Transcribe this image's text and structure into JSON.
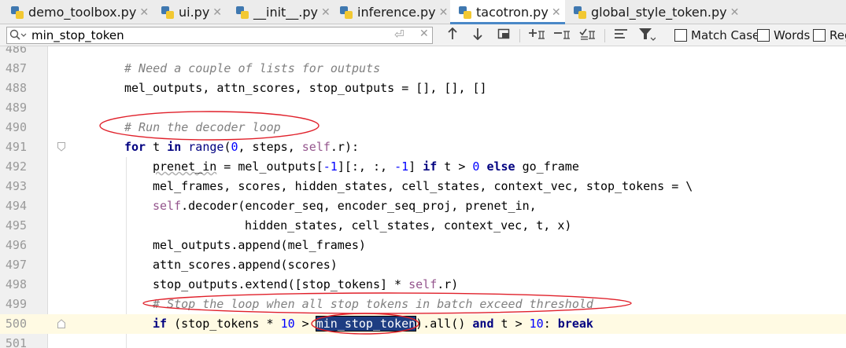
{
  "tabs": [
    {
      "label": "demo_toolbox.py",
      "active": false
    },
    {
      "label": "ui.py",
      "active": false
    },
    {
      "label": "__init__.py",
      "active": false
    },
    {
      "label": "inference.py",
      "active": false
    },
    {
      "label": "tacotron.py",
      "active": true
    },
    {
      "label": "global_style_token.py",
      "active": false
    }
  ],
  "search": {
    "value": "min_stop_token",
    "options": {
      "match_case": "Match Case",
      "words": "Words",
      "regex": "Reg"
    }
  },
  "editor": {
    "first_line_partial": "486",
    "lines": [
      {
        "n": "487",
        "text": "# Need a couple of lists for outputs"
      },
      {
        "n": "488",
        "text": "mel_outputs, attn_scores, stop_outputs = [], [], []"
      },
      {
        "n": "489",
        "text": ""
      },
      {
        "n": "490",
        "text": "# Run the decoder loop"
      },
      {
        "n": "491",
        "text": "for t in range(0, steps, self.r):"
      },
      {
        "n": "492",
        "text": "prenet_in = mel_outputs[-1][:, :, -1] if t > 0 else go_frame"
      },
      {
        "n": "493",
        "text": "mel_frames, scores, hidden_states, cell_states, context_vec, stop_tokens = \\"
      },
      {
        "n": "494",
        "text": "self.decoder(encoder_seq, encoder_seq_proj, prenet_in,"
      },
      {
        "n": "495",
        "text": "hidden_states, cell_states, context_vec, t, x)"
      },
      {
        "n": "496",
        "text": "mel_outputs.append(mel_frames)"
      },
      {
        "n": "497",
        "text": "attn_scores.append(scores)"
      },
      {
        "n": "498",
        "text": "stop_outputs.extend([stop_tokens] * self.r)"
      },
      {
        "n": "499",
        "text": "# Stop the loop when all stop tokens in batch exceed threshold"
      },
      {
        "n": "500",
        "text": "if (stop_tokens * 10 > min_stop_token).all() and t > 10: break"
      },
      {
        "n": "501",
        "text": ""
      }
    ]
  },
  "colors": {
    "comment": "#808080",
    "keyword": "#000080",
    "number": "#0000ff",
    "self": "#94558d",
    "search_match_bg": "#1e3d82",
    "annotation_red": "#e0202a",
    "current_line_bg": "#fffae3"
  },
  "icons": [
    "python-file-icon",
    "close-tab-icon",
    "search-icon",
    "enter-icon",
    "clear-search-icon",
    "arrow-up-icon",
    "arrow-down-icon",
    "select-all-occurrences-icon",
    "add-selection-icon",
    "remove-selection-icon",
    "select-all-icon",
    "filter-icon"
  ]
}
